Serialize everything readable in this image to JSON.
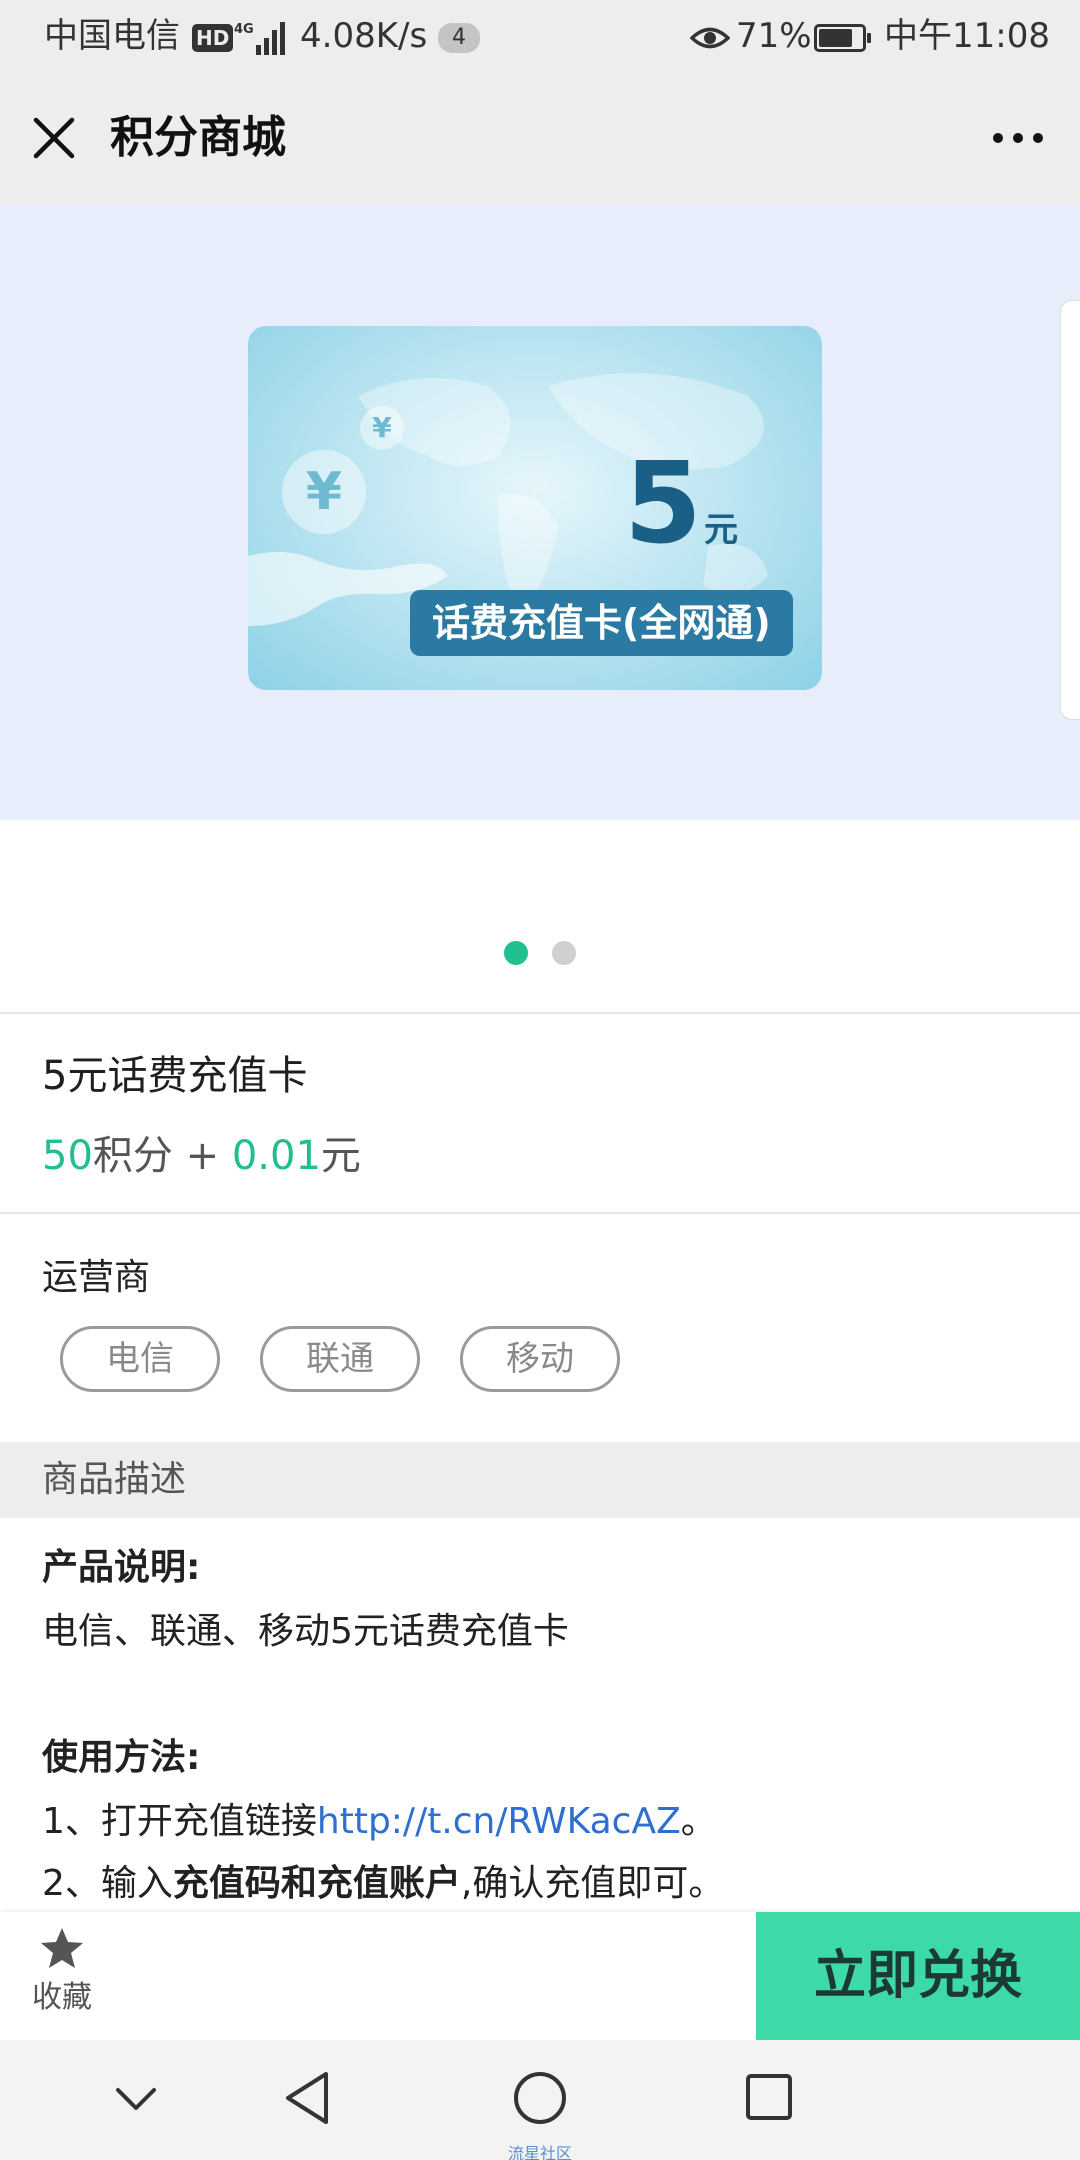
{
  "status_bar": {
    "carrier": "中国电信",
    "hd": "HD",
    "network": "4G",
    "speed": "4.08K/s",
    "notification_count": "4",
    "battery": "71%",
    "battery_level": 0.71,
    "time": "中午11:08"
  },
  "nav": {
    "title": "积分商城",
    "close_icon": "close-icon",
    "more_icon": "more-icon"
  },
  "banner": {
    "card_amount": "5",
    "card_unit": "元",
    "card_label": "话费充值卡(全网通)",
    "currency_symbol": "¥",
    "slide_count": 2,
    "active_slide": 0
  },
  "product": {
    "title": "5元话费充值卡",
    "points": "50",
    "points_unit": "积分",
    "plus": " + ",
    "cash": "0.01",
    "cash_unit": "元"
  },
  "operator": {
    "label": "运营商",
    "options": [
      "电信",
      "联通",
      "移动"
    ]
  },
  "description": {
    "section_title": "商品描述",
    "product_heading": "产品说明:",
    "product_text": "电信、联通、移动5元话费充值卡",
    "usage_heading": "使用方法:",
    "step1_prefix": "1、打开充值链接",
    "step1_link": "http://t.cn/RWKacAZ",
    "step1_suffix": "。",
    "step2_prefix": "2、输入",
    "step2_bold": "充值码和充值账户",
    "step2_suffix": ",确认充值即可。"
  },
  "action_bar": {
    "favorite_label": "收藏",
    "exchange_label": "立即兑换"
  },
  "system_nav": {
    "watermark": "流星社区"
  },
  "colors": {
    "accent": "#1fbf8f",
    "exchange_button": "#3ed9a9",
    "link": "#2e6fd0",
    "banner_bg": "#e8edfc"
  }
}
